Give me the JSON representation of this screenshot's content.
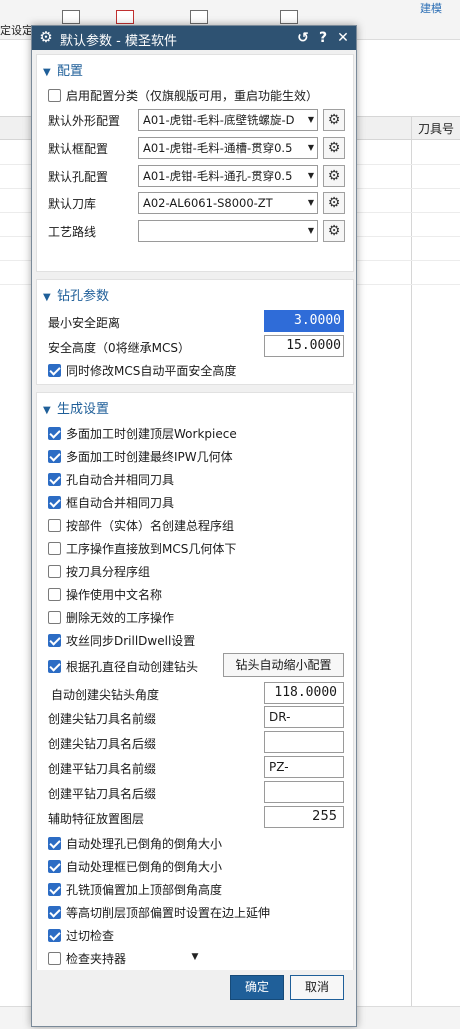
{
  "background": {
    "top_link": "建模",
    "left_text": "定设定",
    "column_header": "刀具号"
  },
  "dialog": {
    "title": "默认参数 - 模圣软件",
    "icons": {
      "title_icon": "gear-icon",
      "reset": "reset-icon",
      "help": "help-icon",
      "close": "close-icon"
    }
  },
  "config": {
    "header": "配置",
    "enable_config_class": {
      "label": "启用配置分类（仅旗舰版可用，重启功能生效）",
      "checked": false
    },
    "rows": [
      {
        "label": "默认外形配置",
        "value": "A01-虎钳-毛料-底壁铣螺旋-D"
      },
      {
        "label": "默认框配置",
        "value": "A01-虎钳-毛料-通槽-贯穿0.5"
      },
      {
        "label": "默认孔配置",
        "value": "A01-虎钳-毛料-通孔-贯穿0.5"
      },
      {
        "label": "默认刀库",
        "value": "A02-AL6061-S8000-ZT"
      },
      {
        "label": "工艺路线",
        "value": ""
      }
    ]
  },
  "drilling": {
    "header": "钻孔参数",
    "min_safe_distance": {
      "label": "最小安全距离",
      "value": "3.0000"
    },
    "safe_height": {
      "label": "安全高度（0将继承MCS）",
      "value": "15.0000"
    },
    "sync_mcs": {
      "label": "同时修改MCS自动平面安全高度",
      "checked": true
    }
  },
  "generation": {
    "header": "生成设置",
    "checks": [
      {
        "label": "多面加工时创建顶层Workpiece",
        "checked": true
      },
      {
        "label": "多面加工时创建最终IPW几何体",
        "checked": true
      },
      {
        "label": "孔自动合并相同刀具",
        "checked": true
      },
      {
        "label": "框自动合并相同刀具",
        "checked": true
      },
      {
        "label": "按部件（实体）名创建总程序组",
        "checked": false
      },
      {
        "label": "工序操作直接放到MCS几何体下",
        "checked": false
      },
      {
        "label": "按刀具分程序组",
        "checked": false
      },
      {
        "label": "操作使用中文名称",
        "checked": false
      },
      {
        "label": "删除无效的工序操作",
        "checked": false
      },
      {
        "label": "攻丝同步DrillDwell设置",
        "checked": true
      },
      {
        "label": "根据孔直径自动创建钻头",
        "checked": true
      }
    ],
    "auto_shrink_button": "钻头自动缩小配置",
    "drill_angle": {
      "label": "自动创建尖钻头角度",
      "value": "118.0000"
    },
    "pointed_prefix": {
      "label": "创建尖钻刀具名前缀",
      "value": "DR-"
    },
    "pointed_suffix": {
      "label": "创建尖钻刀具名后缀",
      "value": ""
    },
    "flat_prefix": {
      "label": "创建平钻刀具名前缀",
      "value": "PZ-"
    },
    "flat_suffix": {
      "label": "创建平钻刀具名后缀",
      "value": ""
    },
    "aux_layer": {
      "label": "辅助特征放置图层",
      "value": "255"
    },
    "checks2": [
      {
        "label": "自动处理孔已倒角的倒角大小",
        "checked": true
      },
      {
        "label": "自动处理框已倒角的倒角大小",
        "checked": true
      },
      {
        "label": "孔铣顶偏置加上顶部倒角高度",
        "checked": true
      },
      {
        "label": "等高切削层顶部偏置时设置在边上延伸",
        "checked": true
      },
      {
        "label": "过切检查",
        "checked": true
      },
      {
        "label": "检查夹持器",
        "checked": false
      }
    ]
  },
  "footer": {
    "ok": "确定",
    "cancel": "取消"
  },
  "colors": {
    "titlebar": "#2e5272",
    "section_header": "#1f5f99",
    "checkbox_on": "#2c6cc4",
    "selected_field": "#2f6cd8"
  }
}
